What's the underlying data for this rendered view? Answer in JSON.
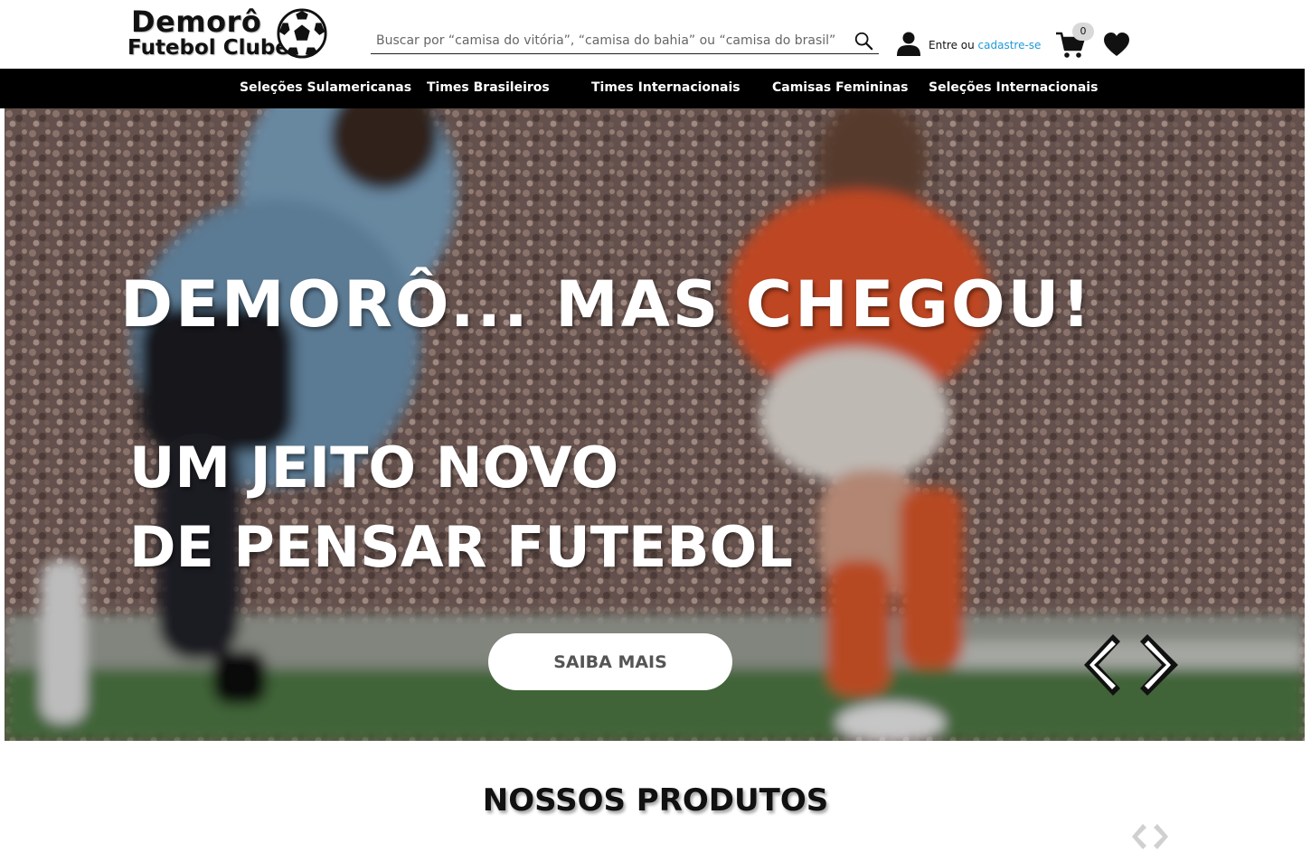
{
  "header": {
    "logo_line1": "Demorô",
    "logo_line2": "Futebol Clube",
    "search_placeholder": "Buscar por “camisa do vitória”, “camisa do bahia” ou “camisa do brasil”",
    "login_prefix": "Entre ou ",
    "login_link": "cadastre-se",
    "cart_count": "0",
    "icons": [
      "soccer-ball-icon",
      "search-icon",
      "user-icon",
      "cart-icon",
      "heart-icon"
    ]
  },
  "nav": {
    "items": [
      {
        "label": "Seleções Sulamericanas"
      },
      {
        "label": "Times Brasileiros"
      },
      {
        "label": "Times Internacionais"
      },
      {
        "label": "Camisas Femininas"
      },
      {
        "label": "Seleções Internacionais"
      }
    ]
  },
  "hero": {
    "title": "DEMORÔ... MAS CHEGOU!",
    "subtitle_line1": "UM JEITO NOVO",
    "subtitle_line2": "DE PENSAR FUTEBOL",
    "button_label": "SAIBA MAIS"
  },
  "products": {
    "title": "NOSSOS PRODUTOS"
  },
  "colors": {
    "nav_bg": "#000000",
    "link": "#1e9bd7",
    "badge": "#d8d8d8",
    "blue_kit": "#7fa6c4",
    "orange_kit": "#e8572a"
  }
}
